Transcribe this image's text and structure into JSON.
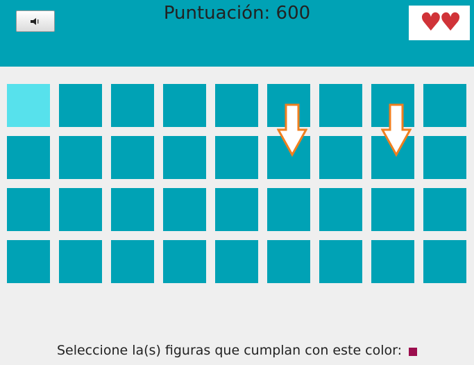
{
  "header": {
    "score_label": "Puntuación:",
    "score_value": "600",
    "sound_button_icon": "speaker-icon",
    "lives_text": "♥♥"
  },
  "board": {
    "rows": 4,
    "cols": 9,
    "selected_cell": [
      0,
      0
    ],
    "marked_cells": [
      [
        0,
        5
      ],
      [
        0,
        7
      ]
    ],
    "marker_icon": "down-arrow-icon"
  },
  "instruction": {
    "text": "Seleccione la(s) figuras que cumplan con este color:",
    "target_color": "#9b0d4d"
  },
  "colors": {
    "header_bg": "#00a2b5",
    "tile": "#00a2b5",
    "tile_selected": "#57e1ec",
    "arrow_outline": "#f07f1f",
    "heart": "#d03338"
  }
}
